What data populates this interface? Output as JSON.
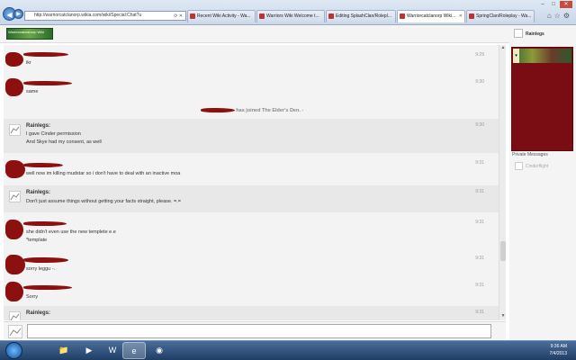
{
  "browser": {
    "address": "http://warriorcatclanorp.wikia.com/wiki/Special:Chat?u",
    "tabs": [
      {
        "label": "Recent Wiki Activity - Wa..."
      },
      {
        "label": "Warriors Wiki Welcome t..."
      },
      {
        "label": "Editing SplashClan/Rolepl..."
      },
      {
        "label": "Warriorcatclanorp Wiki..."
      },
      {
        "label": "SpringClan/Roleplay - Wa..."
      }
    ]
  },
  "chat": {
    "logo_text": "Warriorcatclanorp Wiki",
    "messages": [
      {
        "text": "ikr",
        "time": "9:29"
      },
      {
        "text": "same",
        "time": "9:30"
      },
      {
        "join_text": "has joined The Elder's Den. -"
      },
      {
        "name": "Rainlegs:",
        "lines": [
          "I gave Cinder permission",
          "And Skye had my consent, as well"
        ],
        "time": "9:30"
      },
      {
        "text": "well now im killing mudstar so i don't have to deal with an inactive moa",
        "time": "9:31"
      },
      {
        "name": "Rainlegs:",
        "lines": [
          "Don't just assume things without getting your facts straight, please. =.="
        ],
        "time": "9:31"
      },
      {
        "lines": [
          "she didn't even use the new templete e.e",
          "*template"
        ],
        "time": "9:31"
      },
      {
        "text": "sorry leggu -.",
        "time": "9:31"
      },
      {
        "text": "Sorry",
        "time": "9:31"
      },
      {
        "name": "Rainlegs:",
        "time": "9:31"
      }
    ],
    "input_value": ""
  },
  "sidebar": {
    "username": "Rainlegs",
    "private_label": "Private Messages",
    "pm_user": "Cinderflight"
  },
  "taskbar": {
    "time": "9:36 AM",
    "date": "7/4/2013"
  }
}
